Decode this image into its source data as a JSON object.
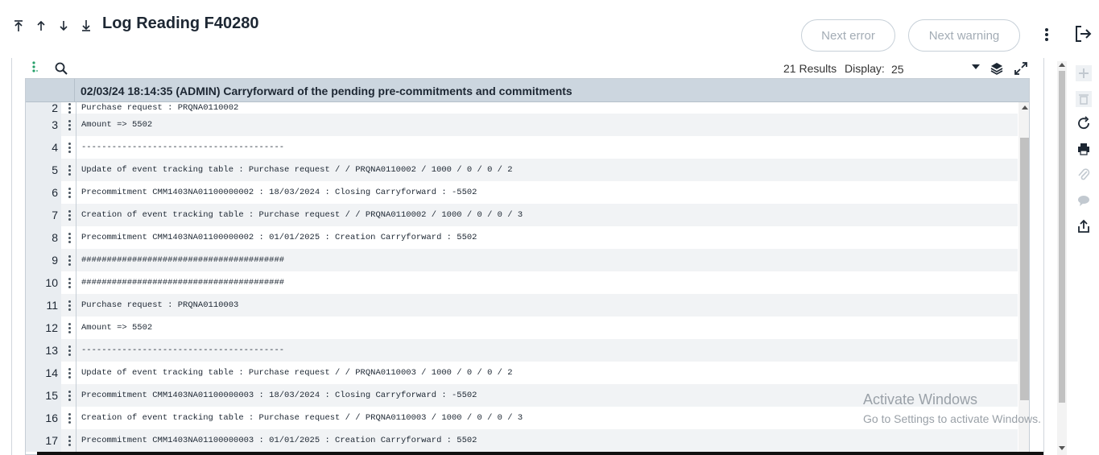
{
  "header": {
    "title": "Log Reading F40280",
    "next_error_label": "Next error",
    "next_warning_label": "Next warning"
  },
  "toolbar": {
    "results_label": "21 Results",
    "display_label": "Display:",
    "display_value": "25"
  },
  "grid": {
    "header_title": "02/03/24 18:14:35 (ADMIN) Carryforward of the pending pre-commitments and commitments",
    "rows": [
      {
        "num": "2",
        "text": "Purchase request : PRQNA0110002"
      },
      {
        "num": "3",
        "text": "Amount => 5502"
      },
      {
        "num": "4",
        "text": "----------------------------------------"
      },
      {
        "num": "5",
        "text": "Update of event tracking table : Purchase request / / PRQNA0110002 / 1000 / 0 / 0 / 2"
      },
      {
        "num": "6",
        "text": "Precommitment CMM1403NA01100000002 : 18/03/2024 : Closing Carryforward : -5502"
      },
      {
        "num": "7",
        "text": "Creation of event tracking table : Purchase request / / PRQNA0110002 / 1000 / 0 / 0 / 3"
      },
      {
        "num": "8",
        "text": "Precommitment CMM1403NA01100000002 : 01/01/2025 : Creation Carryforward : 5502"
      },
      {
        "num": "9",
        "text": "########################################"
      },
      {
        "num": "10",
        "text": "########################################"
      },
      {
        "num": "11",
        "text": "Purchase request : PRQNA0110003"
      },
      {
        "num": "12",
        "text": "Amount => 5502"
      },
      {
        "num": "13",
        "text": "----------------------------------------"
      },
      {
        "num": "14",
        "text": "Update of event tracking table : Purchase request / / PRQNA0110003 / 1000 / 0 / 0 / 2"
      },
      {
        "num": "15",
        "text": "Precommitment CMM1403NA01100000003 : 18/03/2024 : Closing Carryforward : -5502"
      },
      {
        "num": "16",
        "text": "Creation of event tracking table : Purchase request / / PRQNA0110003 / 1000 / 0 / 0 / 3"
      },
      {
        "num": "17",
        "text": "Precommitment CMM1403NA01100000003 : 01/01/2025 : Creation Carryforward : 5502"
      }
    ]
  },
  "watermark": {
    "line1": "Activate Windows",
    "line2": "Go to Settings to activate Windows."
  },
  "icons": {
    "nav": [
      "first-icon",
      "previous-icon",
      "next-icon",
      "last-icon"
    ],
    "side": [
      "add-icon",
      "delete-icon",
      "refresh-icon",
      "print-icon",
      "attachment-icon",
      "comment-icon",
      "export-icon"
    ]
  },
  "colors": {
    "grid_header_bg": "#ccd6df",
    "row_alt_bg": "#f1f3f5",
    "accent_green": "#27a06b"
  }
}
